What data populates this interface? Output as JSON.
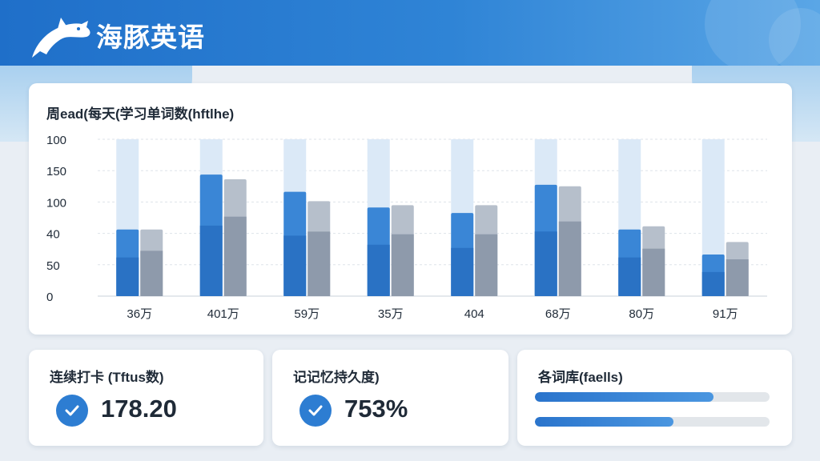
{
  "app": {
    "title": "海豚英语"
  },
  "chart_card": {
    "title": "周ead(每天(学习单词数(hftlhe)"
  },
  "chart_data": {
    "type": "bar",
    "categories": [
      "36万",
      "401万",
      "59万",
      "35万",
      "404",
      "68万",
      "80万",
      "91万"
    ],
    "y_tick_labels": [
      "0",
      "50",
      "40",
      "100",
      "150",
      "100"
    ],
    "ylim": [
      0,
      200
    ],
    "grid": true,
    "series": [
      {
        "values": [
          85,
          155,
          133,
          113,
          106,
          142,
          85,
          53
        ]
      },
      {
        "values": [
          85,
          149,
          121,
          116,
          116,
          140,
          89,
          69
        ]
      }
    ],
    "colors": {
      "series_a": "#3a86d6",
      "series_b": "#b6bfcb",
      "track": "#dbe9f7"
    }
  },
  "stats": [
    {
      "title": "连续打卡 (Tftus数)",
      "value": "178.20",
      "icon": "check-circle-icon"
    },
    {
      "title": "记记忆持久度)",
      "value": "753%",
      "icon": "check-circle-icon"
    }
  ],
  "vocab_card": {
    "title": "各词库(faells)",
    "bars": [
      {
        "progress": 0.76
      },
      {
        "progress": 0.59
      }
    ]
  }
}
